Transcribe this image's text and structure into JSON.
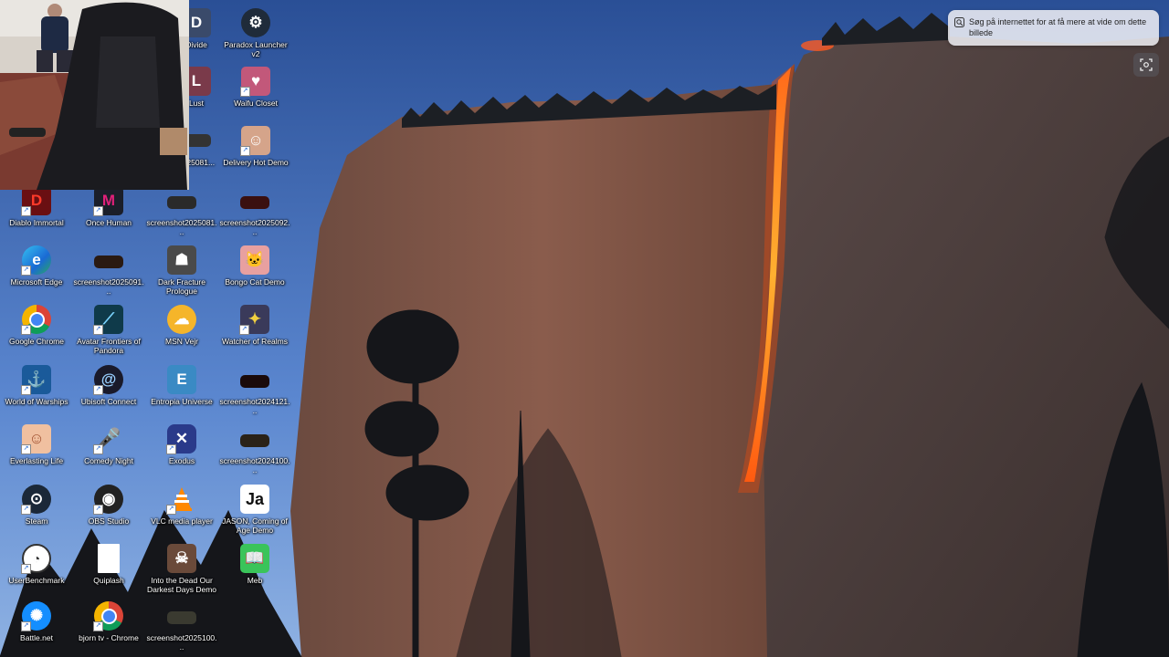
{
  "desktop": {
    "icons": [
      {
        "label": "Divide",
        "icon": "game-icon",
        "color": "#3a4a6a"
      },
      {
        "label": "Paradox Launcher v2",
        "icon": "paradox-icon",
        "color": "#1f2b3a"
      },
      {
        "label": "Lust",
        "icon": "game-icon",
        "color": "#7a3a4a"
      },
      {
        "label": "Waifu Closet",
        "icon": "anime-icon",
        "color": "#c2587a"
      },
      {
        "label": "2025081...",
        "icon": "screenshot-icon",
        "color": "#333333"
      },
      {
        "label": "Delivery Hot Demo",
        "icon": "anime-icon",
        "color": "#d5a48a"
      },
      {
        "label": "Diablo Immortal",
        "icon": "diablo-icon",
        "color": "#6a0f12"
      },
      {
        "label": "Once Human",
        "icon": "once-human-icon",
        "color": "#1b1f2a"
      },
      {
        "label": "screenshot2025081...",
        "icon": "screenshot-icon",
        "color": "#2a2a2a"
      },
      {
        "label": "screenshot2025092...",
        "icon": "screenshot-icon",
        "color": "#3a1010"
      },
      {
        "label": "Microsoft Edge",
        "icon": "edge-icon",
        "color": "#1a8ad4"
      },
      {
        "label": "screenshot2025091...",
        "icon": "screenshot-icon",
        "color": "#2a1a12"
      },
      {
        "label": "Dark Fracture Prologue",
        "icon": "game-icon",
        "color": "#4a4a4a"
      },
      {
        "label": "Bongo Cat Demo",
        "icon": "bongo-cat-icon",
        "color": "#e8a0a0"
      },
      {
        "label": "Google Chrome",
        "icon": "chrome-icon",
        "color": "#ffffff"
      },
      {
        "label": "Avatar Frontiers of Pandora",
        "icon": "avatar-icon",
        "color": "#0f3a4a"
      },
      {
        "label": "MSN Vejr",
        "icon": "weather-icon",
        "color": "#f5b52a"
      },
      {
        "label": "Watcher of Realms",
        "icon": "game-icon",
        "color": "#3a3a5a"
      },
      {
        "label": "World of Warships",
        "icon": "warships-icon",
        "color": "#1a5a9a"
      },
      {
        "label": "Ubisoft Connect",
        "icon": "ubisoft-icon",
        "color": "#1a1a2a"
      },
      {
        "label": "Entropia Universe",
        "icon": "entropia-icon",
        "color": "#3a8ac4"
      },
      {
        "label": "screenshot2024121...",
        "icon": "screenshot-icon",
        "color": "#1a0a0a"
      },
      {
        "label": "Everlasting Life",
        "icon": "anime-icon",
        "color": "#f0c0a0"
      },
      {
        "label": "Comedy Night",
        "icon": "microphone-icon",
        "color": "#9a9aa0"
      },
      {
        "label": "Exodus",
        "icon": "exodus-icon",
        "color": "#2a3a8a"
      },
      {
        "label": "screenshot2024100...",
        "icon": "screenshot-icon",
        "color": "#2a2218"
      },
      {
        "label": "Steam",
        "icon": "steam-icon",
        "color": "#1b2838"
      },
      {
        "label": "OBS Studio",
        "icon": "obs-icon",
        "color": "#222222"
      },
      {
        "label": "VLC media player",
        "icon": "vlc-icon",
        "color": "#ff8800"
      },
      {
        "label": "JASON, Coming of Age Demo",
        "icon": "jason-icon",
        "color": "#ffffff"
      },
      {
        "label": "UserBenchmark",
        "icon": "benchmark-icon",
        "color": "#ffffff"
      },
      {
        "label": "Quiplash",
        "icon": "document-icon",
        "color": "#ffffff"
      },
      {
        "label": "Into the Dead Our Darkest Days Demo",
        "icon": "game-icon",
        "color": "#6a4a3a"
      },
      {
        "label": "Meb",
        "icon": "book-icon",
        "color": "#3ac45a"
      },
      {
        "label": "Battle.net",
        "icon": "battlenet-icon",
        "color": "#148eff"
      },
      {
        "label": "bjorn tv - Chrome",
        "icon": "chrome-icon",
        "color": "#ffffff"
      },
      {
        "label": "screenshot2025100...",
        "icon": "screenshot-icon",
        "color": "#3a3a30"
      }
    ]
  },
  "visual_search": {
    "text": "Søg på internettet for at få mere at vide om dette billede",
    "icon": "visual-search-icon",
    "lens_icon": "lens-icon"
  },
  "webcam": {
    "icon": "webcam-feed"
  },
  "wallpaper": {
    "subject": "firefall-waterfall"
  }
}
